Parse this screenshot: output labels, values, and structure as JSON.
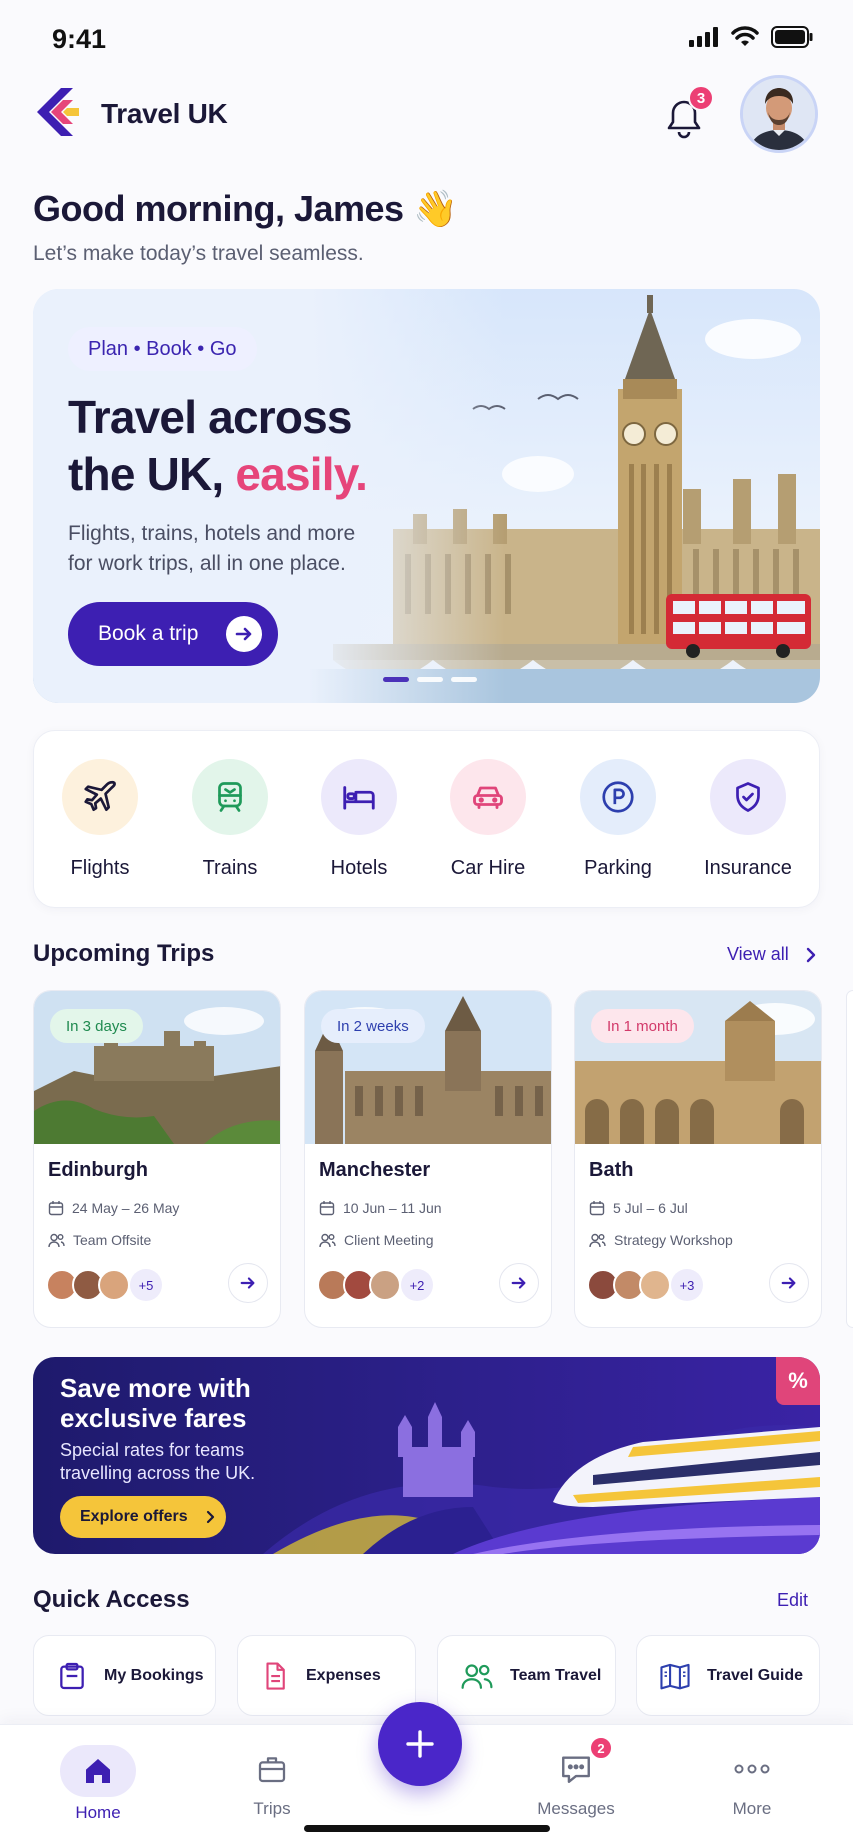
{
  "status": {
    "time": "9:41"
  },
  "header": {
    "app_title": "Travel UK",
    "notifications_count": "3"
  },
  "greeting": {
    "title": "Good morning, James 👋",
    "subtitle": "Let’s make today’s travel seamless."
  },
  "hero": {
    "tag": "Plan • Book • Go",
    "title_line1": "Travel across",
    "title_line2_prefix": "the UK, ",
    "title_accent": "easily.",
    "description": "Flights, trains, hotels and more for work trips, all in one place.",
    "button_label": "Book a trip",
    "slides_active_index": 0
  },
  "categories": [
    {
      "label": "Flights",
      "icon": "plane-icon",
      "bg": "#fdf1dd",
      "color": "#1b1838"
    },
    {
      "label": "Trains",
      "icon": "train-icon",
      "bg": "#e2f5ea",
      "color": "#1f9a5a"
    },
    {
      "label": "Hotels",
      "icon": "bed-icon",
      "bg": "#ece9fb",
      "color": "#3d1fb2"
    },
    {
      "label": "Car Hire",
      "icon": "car-icon",
      "bg": "#fde6ec",
      "color": "#e0457a"
    },
    {
      "label": "Parking",
      "icon": "parking-icon",
      "bg": "#e4edfb",
      "color": "#2d3fae"
    },
    {
      "label": "Insurance",
      "icon": "shield-icon",
      "bg": "#ece9fb",
      "color": "#3d1fb2"
    }
  ],
  "upcoming": {
    "title": "Upcoming Trips",
    "view_all": "View all",
    "trips": [
      {
        "badge": "In 3 days",
        "badge_bg": "#e3f6ea",
        "badge_color": "#1f8a4f",
        "city": "Edinburgh",
        "dates": "24 May – 26 May",
        "purpose": "Team Offsite",
        "extra": "+5"
      },
      {
        "badge": "In 2 weeks",
        "badge_bg": "#e6eefc",
        "badge_color": "#2d3fae",
        "city": "Manchester",
        "dates": "10 Jun – 11 Jun",
        "purpose": "Client Meeting",
        "extra": "+2"
      },
      {
        "badge": "In 1 month",
        "badge_bg": "#fde6ec",
        "badge_color": "#d23a6a",
        "city": "Bath",
        "dates": "5 Jul – 6 Jul",
        "purpose": "Strategy Workshop",
        "extra": "+3"
      }
    ]
  },
  "promo": {
    "title": "Save more with exclusive fares",
    "description": "Special rates for teams travelling across the UK.",
    "button_label": "Explore offers",
    "badge": "%"
  },
  "quick_access": {
    "title": "Quick Access",
    "edit": "Edit",
    "items": [
      {
        "label": "My Bookings",
        "icon": "clipboard-icon"
      },
      {
        "label": "Expenses",
        "icon": "receipt-icon"
      },
      {
        "label": "Team Travel",
        "icon": "team-icon"
      },
      {
        "label": "Travel Guide",
        "icon": "map-icon"
      }
    ]
  },
  "nav": {
    "home": "Home",
    "trips": "Trips",
    "messages": "Messages",
    "messages_count": "2",
    "more": "More"
  }
}
